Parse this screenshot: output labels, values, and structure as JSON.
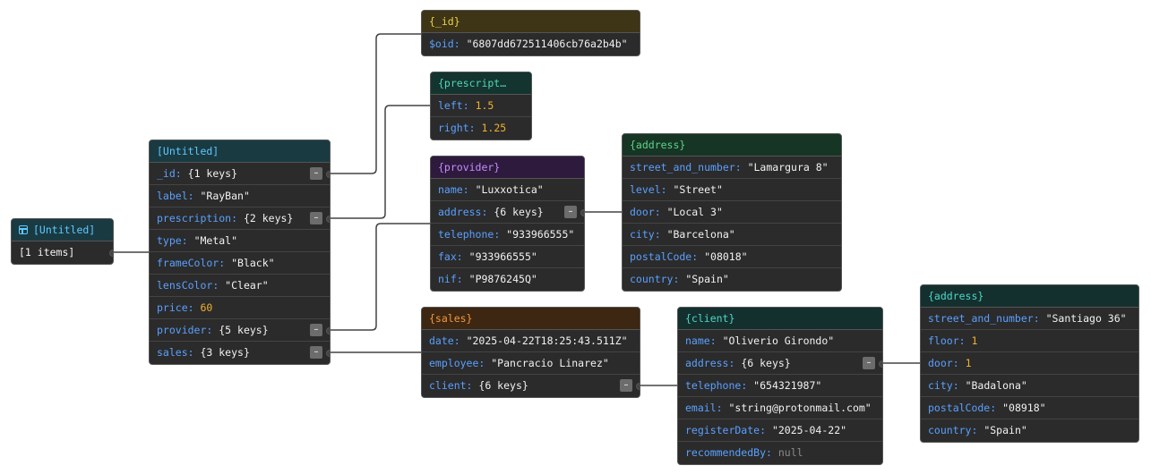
{
  "root": {
    "title": "[Untitled]",
    "items": "[1 items]"
  },
  "untitled": {
    "title": "[Untitled]",
    "rows": [
      {
        "key": "_id",
        "value": "{1 keys}"
      },
      {
        "key": "label",
        "value": "\"RayBan\""
      },
      {
        "key": "prescription",
        "value": "{2 keys}"
      },
      {
        "key": "type",
        "value": "\"Metal\""
      },
      {
        "key": "frameColor",
        "value": "\"Black\""
      },
      {
        "key": "lensColor",
        "value": "\"Clear\""
      },
      {
        "key": "price",
        "value": "60"
      },
      {
        "key": "provider",
        "value": "{5 keys}"
      },
      {
        "key": "sales",
        "value": "{3 keys}"
      }
    ]
  },
  "id_node": {
    "title": "{_id}",
    "rows": [
      {
        "key": "$oid",
        "value": "\"6807dd672511406cb76a2b4b\""
      }
    ]
  },
  "prescription_node": {
    "title": "{prescript…",
    "rows": [
      {
        "key": "left",
        "value": "1.5"
      },
      {
        "key": "right",
        "value": "1.25"
      }
    ]
  },
  "provider_node": {
    "title": "{provider}",
    "rows": [
      {
        "key": "name",
        "value": "\"Luxxotica\""
      },
      {
        "key": "address",
        "value": "{6 keys}"
      },
      {
        "key": "telephone",
        "value": "\"933966555\""
      },
      {
        "key": "fax",
        "value": "\"933966555\""
      },
      {
        "key": "nif",
        "value": "\"P9876245Q\""
      }
    ]
  },
  "provider_address": {
    "title": "{address}",
    "rows": [
      {
        "key": "street_and_number",
        "value": "\"Lamargura 8\""
      },
      {
        "key": "level",
        "value": "\"Street\""
      },
      {
        "key": "door",
        "value": "\"Local 3\""
      },
      {
        "key": "city",
        "value": "\"Barcelona\""
      },
      {
        "key": "postalCode",
        "value": "\"08018\""
      },
      {
        "key": "country",
        "value": "\"Spain\""
      }
    ]
  },
  "sales_node": {
    "title": "{sales}",
    "rows": [
      {
        "key": "date",
        "value": "\"2025-04-22T18:25:43.511Z\""
      },
      {
        "key": "employee",
        "value": "\"Pancracio Linarez\""
      },
      {
        "key": "client",
        "value": "{6 keys}"
      }
    ]
  },
  "client_node": {
    "title": "{client}",
    "rows": [
      {
        "key": "name",
        "value": "\"Oliverio Girondo\""
      },
      {
        "key": "address",
        "value": "{6 keys}"
      },
      {
        "key": "telephone",
        "value": "\"654321987\""
      },
      {
        "key": "email",
        "value": "\"string@protonmail.com\""
      },
      {
        "key": "registerDate",
        "value": "\"2025-04-22\""
      },
      {
        "key": "recommendedBy",
        "value": "null"
      }
    ]
  },
  "client_address": {
    "title": "{address}",
    "rows": [
      {
        "key": "street_and_number",
        "value": "\"Santiago 36\""
      },
      {
        "key": "floor",
        "value": "1"
      },
      {
        "key": "door",
        "value": "1"
      },
      {
        "key": "city",
        "value": "\"Badalona\""
      },
      {
        "key": "postalCode",
        "value": "\"08918\""
      },
      {
        "key": "country",
        "value": "\"Spain\""
      }
    ]
  },
  "collapse_symbol": "–",
  "colors": {
    "canvas": "#ffffff",
    "node_bg": "#2b2b2b",
    "key": "#5aa0ff",
    "number": "#f0b030",
    "edge": "#444444",
    "header_array": "#1a3a42",
    "header_id": "#3d3516",
    "header_prescription": "#14342f",
    "header_provider": "#2e1a3d",
    "header_address": "#173524",
    "header_sales": "#3d2713",
    "header_client": "#14302e"
  },
  "icons": [
    "table-icon",
    "collapse-icon"
  ]
}
